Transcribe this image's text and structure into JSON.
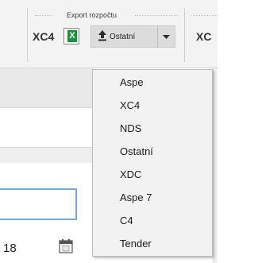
{
  "ribbon": {
    "group_title": "Export rozpočtu",
    "buttons": {
      "xc4_label": "XC4",
      "excel_icon": "excel-icon",
      "ostatni_label": "Ostatní",
      "xc4_partial_label": "XC"
    }
  },
  "workspace": {
    "field_value": "18",
    "calendar_icon": "calendar-icon"
  },
  "dropdown": {
    "items": [
      {
        "label": "Aspe"
      },
      {
        "label": "XC4"
      },
      {
        "label": "NDS"
      },
      {
        "label": "Ostatní"
      },
      {
        "label": "XDC"
      },
      {
        "label": "Aspe 7"
      },
      {
        "label": "C4"
      },
      {
        "label": "Tender"
      }
    ]
  },
  "colors": {
    "accent_focus": "#7ea5d3",
    "excel_green": "#1f8f3f",
    "menu_bg": "#f2f2f2"
  }
}
